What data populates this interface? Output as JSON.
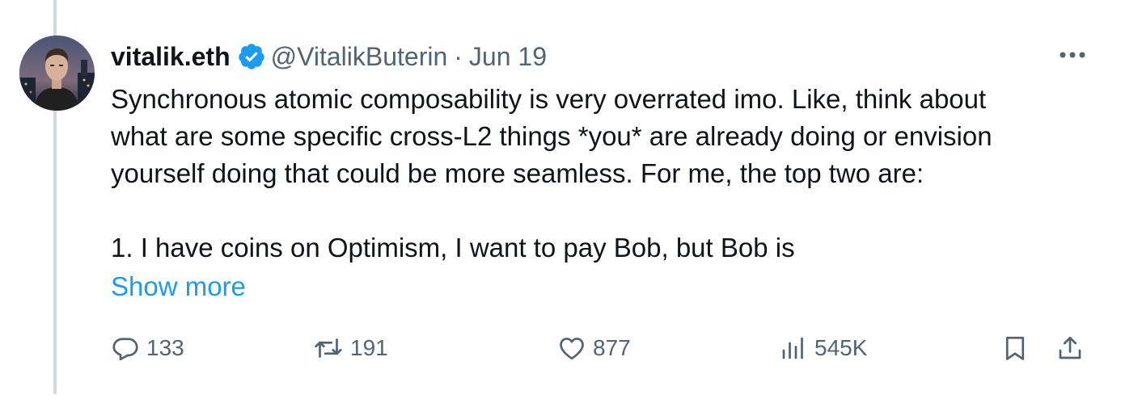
{
  "tweet": {
    "display_name": "vitalik.eth",
    "handle": "@VitalikButerin",
    "separator": "·",
    "date": "Jun 19",
    "text": "Synchronous atomic composability is very overrated imo. Like, think about\nwhat are some specific cross-L2 things *you* are already doing or envision\nyourself doing that could be more seamless. For me, the top two are:\n\n1. I have coins on Optimism, I want to pay Bob, but Bob is",
    "show_more": "Show more",
    "replies": "133",
    "retweets": "191",
    "likes": "877",
    "views": "545K"
  },
  "icons": {
    "verified": "verified-badge-icon",
    "more": "more-options-icon",
    "reply": "reply-icon",
    "retweet": "retweet-icon",
    "like": "heart-icon",
    "views": "views-chart-icon",
    "bookmark": "bookmark-icon",
    "share": "share-icon"
  },
  "colors": {
    "text": "#0f1419",
    "muted": "#536471",
    "link": "#1d9bf0",
    "verified": "#1d9bf0",
    "thread_line": "#cfd9de"
  }
}
